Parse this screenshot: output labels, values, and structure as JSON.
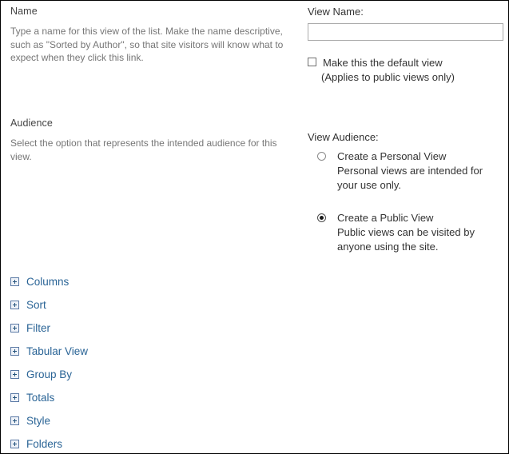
{
  "sections": {
    "name": {
      "title": "Name",
      "description": "Type a name for this view of the list. Make the name descriptive, such as \"Sorted by Author\", so that site visitors will know what to expect when they click this link.",
      "view_name_label": "View Name:",
      "view_name_value": "",
      "view_name_placeholder": "",
      "default_view_checkbox_label": "Make this the default view",
      "default_view_checkbox_sublabel": "(Applies to public views only)",
      "default_view_checked": false
    },
    "audience": {
      "title": "Audience",
      "description": "Select the option that represents the intended audience for this view.",
      "view_audience_label": "View Audience:",
      "options": [
        {
          "label": "Create a Personal View",
          "description": "Personal views are intended for your use only.",
          "selected": false
        },
        {
          "label": "Create a Public View",
          "description": "Public views can be visited by anyone using the site.",
          "selected": true
        }
      ]
    }
  },
  "expandable_sections": [
    {
      "label": "Columns",
      "icon": "expand-plus-icon"
    },
    {
      "label": "Sort",
      "icon": "expand-plus-icon"
    },
    {
      "label": "Filter",
      "icon": "expand-plus-icon"
    },
    {
      "label": "Tabular View",
      "icon": "expand-plus-icon"
    },
    {
      "label": "Group By",
      "icon": "expand-plus-icon"
    },
    {
      "label": "Totals",
      "icon": "expand-plus-icon"
    },
    {
      "label": "Style",
      "icon": "expand-plus-icon"
    },
    {
      "label": "Folders",
      "icon": "expand-plus-icon"
    }
  ],
  "colors": {
    "link": "#2a6496",
    "body_text": "#767676",
    "label_text": "#333333",
    "section_title": "#444444",
    "input_border": "#ababab",
    "frame_border": "#000000"
  }
}
